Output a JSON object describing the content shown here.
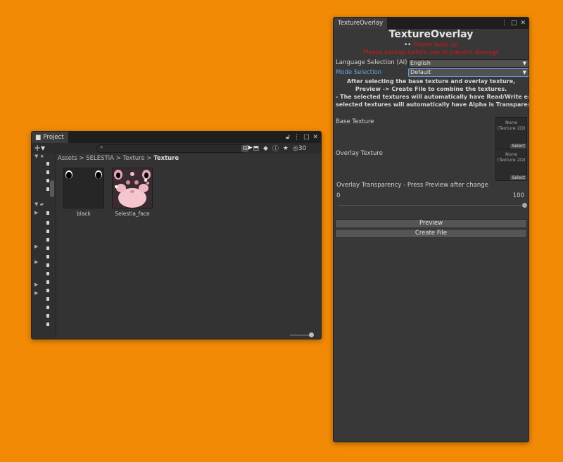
{
  "project": {
    "tab_label": "Project",
    "breadcrumb": {
      "root": "Assets",
      "sep": ">",
      "folder": "SELESTIA",
      "sub": "Texture",
      "current": "Texture"
    },
    "hidden_count": "30",
    "assets": [
      {
        "name": "black"
      },
      {
        "name": "Selestia_face"
      }
    ]
  },
  "overlay": {
    "tab_label": "TextureOverlay",
    "title": "TextureOverlay",
    "notice_line1": "Please back up",
    "notice_line2": "Please backup before use to prevent damage",
    "language_label": "Language Selection (AI)",
    "language_value": "English",
    "mode_label": "Mode Selection",
    "mode_value": "Default",
    "info1": "After selecting the base texture and overlay texture,",
    "info2": "Preview -> Create File to combine the textures.",
    "info3": "- The selected textures will automatically have Read/Write enabled.",
    "info4": "selected textures will automatically have Alpha is Transparency ena",
    "base_label": "Base Texture",
    "overlay_label": "Overlay Texture",
    "field_none": "None",
    "field_type": "(Texture 2D)",
    "field_select": "Select",
    "transparency_label": "Overlay Transparency - Press Preview after change",
    "slider_min": "0",
    "slider_max": "100",
    "preview_button": "Preview",
    "create_button": "Create File"
  }
}
